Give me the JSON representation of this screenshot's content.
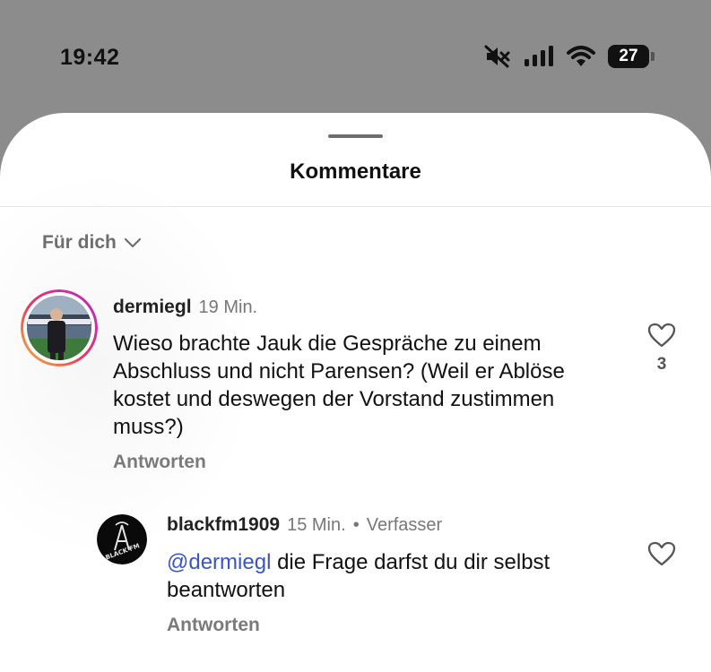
{
  "status_bar": {
    "time": "19:42",
    "battery": "27"
  },
  "sheet": {
    "title": "Kommentare",
    "sort_label": "Für dich"
  },
  "comments": [
    {
      "username": "dermiegl",
      "time": "19 Min.",
      "text": "Wieso brachte Jauk die Gespräche zu einem Abschluss und nicht Parensen? (Weil er Ablöse kostet und deswegen der Vorstand zustimmen muss?)",
      "reply_label": "Antworten",
      "likes": "3"
    }
  ],
  "reply": {
    "username": "blackfm1909",
    "time": "15 Min.",
    "separator": "•",
    "badge": "Verfasser",
    "mention": "@dermiegl",
    "text": " die Frage darfst du dir selbst beantworten",
    "reply_label": "Antworten",
    "avatar_text": "BLACK FM"
  },
  "colors": {
    "accent_mention": "#3955c2",
    "backdrop": "#8c8c8c"
  },
  "icons": [
    "mute-icon",
    "signal-icon",
    "wifi-icon",
    "battery-icon",
    "chevron-down-icon",
    "heart-icon"
  ]
}
